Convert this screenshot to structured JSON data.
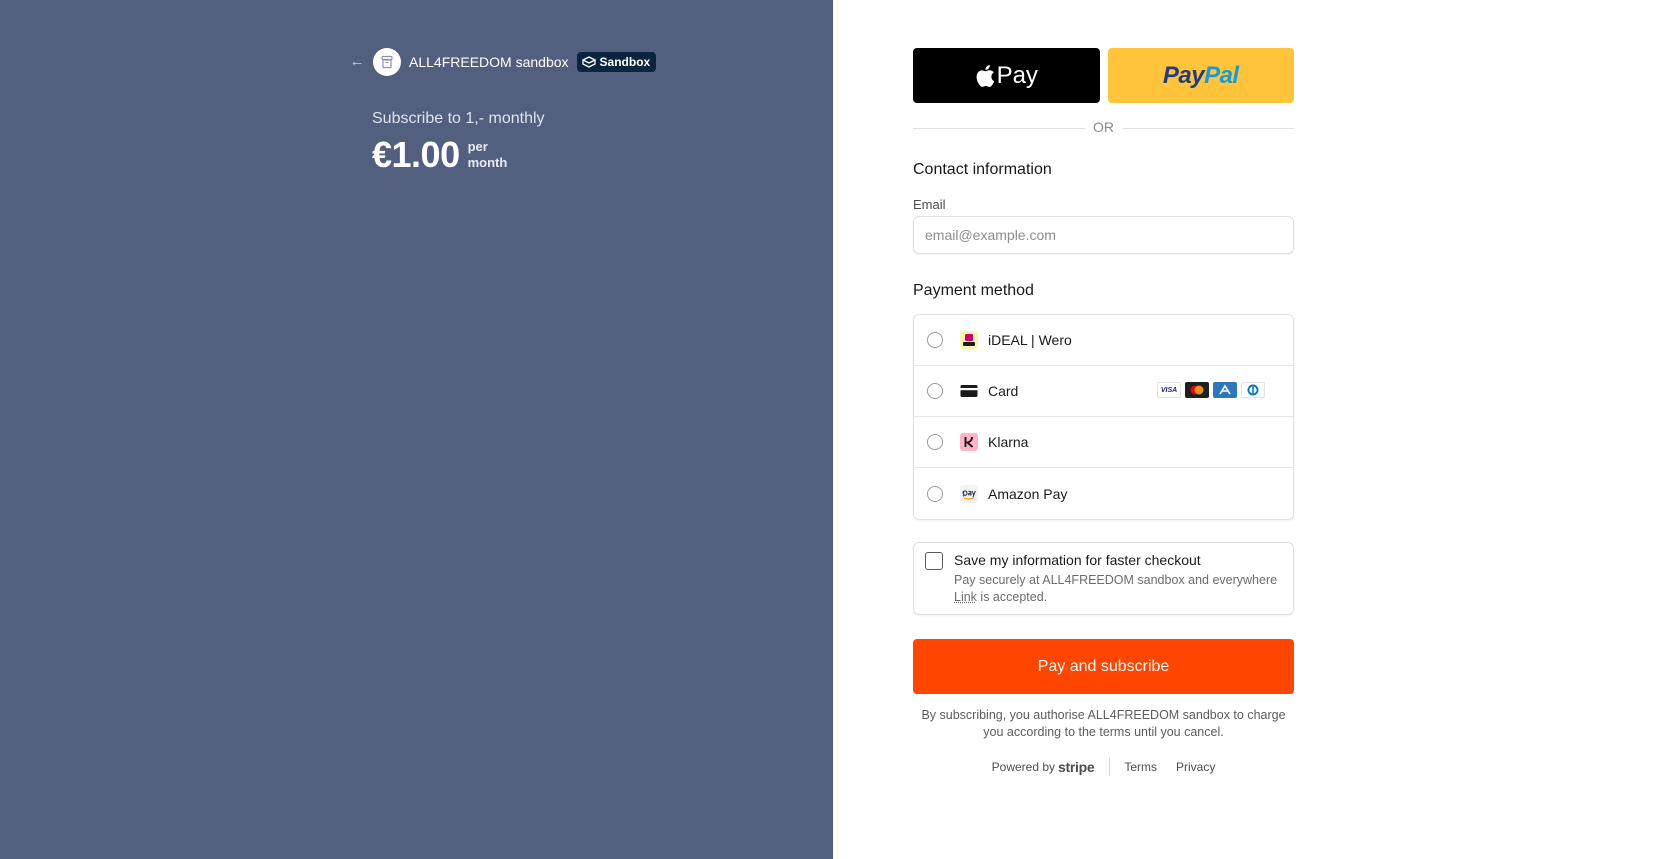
{
  "merchant": {
    "name": "ALL4FREEDOM sandbox",
    "badge": "Sandbox"
  },
  "summary": {
    "product": "Subscribe to 1,- monthly",
    "price": "€1.00",
    "period_line1": "per",
    "period_line2": "month"
  },
  "wallets": {
    "apple_label": "Pay",
    "paypal_part1": "Pay",
    "paypal_part2": "Pal"
  },
  "divider": "OR",
  "contact": {
    "title": "Contact information",
    "email_label": "Email",
    "email_placeholder": "email@example.com",
    "email_value": ""
  },
  "payment": {
    "title": "Payment method",
    "methods": [
      {
        "label": "iDEAL | Wero",
        "icon": "ideal-icon"
      },
      {
        "label": "Card",
        "icon": "card-icon",
        "brands": [
          "VISA",
          "Mastercard",
          "AMEX",
          "Diners"
        ]
      },
      {
        "label": "Klarna",
        "icon": "klarna-icon"
      },
      {
        "label": "Amazon Pay",
        "icon": "amazon-pay-icon"
      }
    ]
  },
  "save": {
    "title": "Save my information for faster checkout",
    "desc_prefix": "Pay securely at ALL4FREEDOM sandbox and everywhere",
    "desc_link": "Link",
    "desc_suffix": " is accepted.",
    "checked": false
  },
  "pay_button": "Pay and subscribe",
  "legal": "By subscribing, you authorise ALL4FREEDOM sandbox to charge you according to the terms until you cancel.",
  "footer": {
    "powered_by": "Powered by",
    "stripe": "stripe",
    "terms": "Terms",
    "privacy": "Privacy"
  },
  "colors": {
    "left_panel": "#525f7f",
    "pay_button": "#ff4500",
    "paypal": "#ffc439",
    "apple_pay": "#000000"
  }
}
